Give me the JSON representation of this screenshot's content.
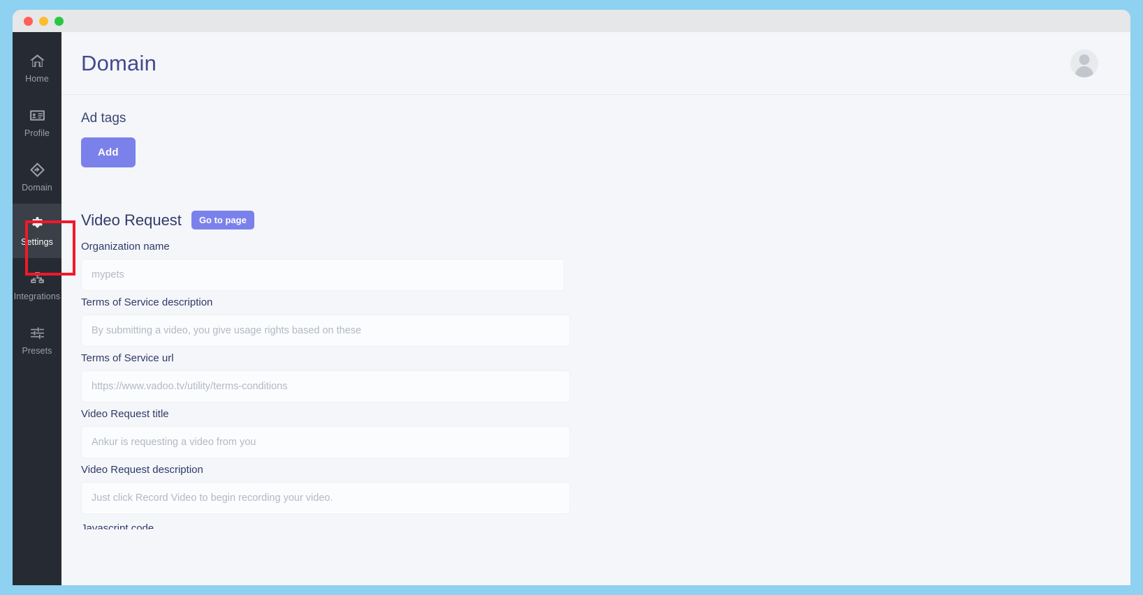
{
  "window": {
    "traffic_lights": [
      "close",
      "minimize",
      "maximize"
    ]
  },
  "sidebar": {
    "items": [
      {
        "label": "Home",
        "icon": "home-icon",
        "active": false
      },
      {
        "label": "Profile",
        "icon": "id-card-icon",
        "active": false
      },
      {
        "label": "Domain",
        "icon": "share-icon",
        "active": false
      },
      {
        "label": "Settings",
        "icon": "gear-icon",
        "active": true
      },
      {
        "label": "Integrations",
        "icon": "sitemap-icon",
        "active": false
      },
      {
        "label": "Presets",
        "icon": "sliders-icon",
        "active": false
      }
    ]
  },
  "header": {
    "title": "Domain",
    "avatar": "user-avatar-icon"
  },
  "main": {
    "ad_tags": {
      "title": "Ad tags",
      "add_label": "Add"
    },
    "video_request": {
      "title": "Video Request",
      "go_to_page_label": "Go to page",
      "fields": [
        {
          "label": "Organization name",
          "placeholder": "mypets",
          "value": ""
        },
        {
          "label": "Terms of Service description",
          "placeholder": "By submitting a video, you give usage rights based on these",
          "value": ""
        },
        {
          "label": "Terms of Service url",
          "placeholder": "https://www.vadoo.tv/utility/terms-conditions",
          "value": ""
        },
        {
          "label": "Video Request title",
          "placeholder": "Ankur is requesting a video from you",
          "value": ""
        },
        {
          "label": "Video Request description",
          "placeholder": "Just click Record Video to begin recording your video.",
          "value": ""
        }
      ],
      "next_field_label": "Javascript code"
    }
  },
  "annotation": {
    "target": "Settings",
    "color": "#f0192a"
  },
  "colors": {
    "accent": "#7b81ea",
    "sidebar_bg": "#262b33",
    "page_bg": "#f4f6fa",
    "title_color": "#434a8c",
    "outer_bg": "#8ed1f0"
  }
}
